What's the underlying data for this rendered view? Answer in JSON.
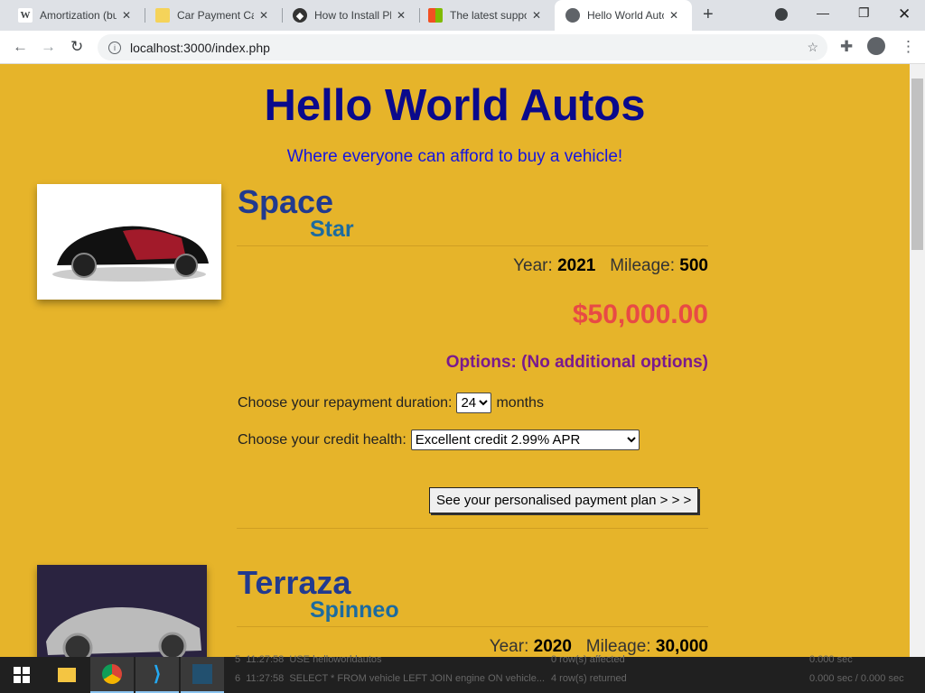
{
  "browser": {
    "tabs": [
      {
        "title": "Amortization (bu",
        "icon": "wikipedia-icon"
      },
      {
        "title": "Car Payment Cal",
        "icon": "calculator-site-icon"
      },
      {
        "title": "How to Install Pl",
        "icon": "site-icon"
      },
      {
        "title": "The latest suppo",
        "icon": "microsoft-icon"
      },
      {
        "title": "Hello World Auto",
        "icon": "globe-icon",
        "active": true
      }
    ],
    "url": "localhost:3000/index.php"
  },
  "page": {
    "title": "Hello World Autos",
    "tagline": "Where everyone can afford to buy a vehicle!",
    "year_label": "Year:",
    "mileage_label": "Mileage:",
    "duration_label": "Choose your repayment duration:",
    "months_label": "months",
    "credit_label": "Choose your credit health:",
    "button_label": "See your personalised payment plan > > >",
    "cars": [
      {
        "make": "Space",
        "model": "Star",
        "year": "2021",
        "mileage": "500",
        "price": "$50,000.00",
        "options": "Options: (No additional options)",
        "duration": "24",
        "credit": "Excellent credit 2.99% APR"
      },
      {
        "make": "Terraza",
        "model": "Spinneo",
        "year": "2020",
        "mileage": "30,000"
      }
    ]
  },
  "taskbar_log": [
    {
      "n": "5",
      "time": "11:27:58",
      "query": "USE helloworldautos",
      "result": "0 row(s) affected",
      "dur": "0.000 sec"
    },
    {
      "n": "6",
      "time": "11:27:58",
      "query": "SELECT * FROM vehicle LEFT JOIN engine ON vehicle...",
      "result": "4 row(s) returned",
      "dur": "0.000 sec / 0.000 sec"
    }
  ]
}
